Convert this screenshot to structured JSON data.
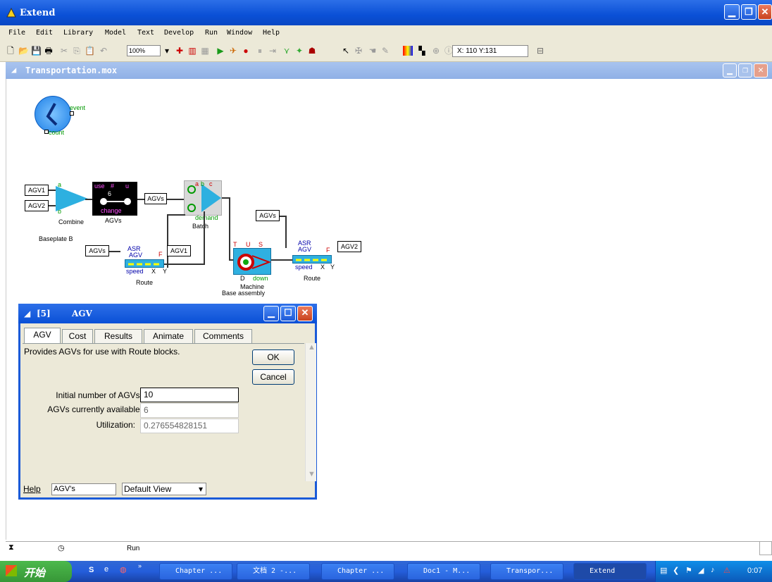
{
  "app": {
    "title": "Extend"
  },
  "menu": [
    "File",
    "Edit",
    "Library",
    "Model",
    "Text",
    "Develop",
    "Run",
    "Window",
    "Help"
  ],
  "toolbar": {
    "zoom": "100%",
    "coords": "X: 110 Y:131"
  },
  "document": {
    "title": "Transportation.mox"
  },
  "blocks": {
    "executive": {
      "output": "event",
      "input": "count"
    },
    "agv1_label": "AGV1",
    "agv2_label": "AGV2",
    "agvs_label": "AGVs",
    "agv1_route_label": "AGV1",
    "agv2_route_label": "AGV2",
    "combine": "Combine",
    "resource_pool": {
      "label": "AGVs",
      "top": "use",
      "hash": "#",
      "u": "u",
      "change": "change",
      "count": "6"
    },
    "batch": {
      "label": "Batch",
      "demand": "demand"
    },
    "machine": {
      "label": "Machine",
      "sublabel": "Base assembly",
      "t": "T",
      "u": "U",
      "s": "S",
      "d": "D",
      "down": "down"
    },
    "route1": {
      "label": "Route",
      "asr": "ASR",
      "agv": "AGV",
      "speed": "speed",
      "x": "X",
      "y": "Y",
      "f": "F"
    },
    "route2": {
      "label": "Route",
      "asr": "ASR",
      "agv": "AGV",
      "speed": "speed",
      "x": "X",
      "y": "Y",
      "f": "F"
    },
    "baseplate": "Baseplate B",
    "ports": {
      "a": "a",
      "b": "b",
      "c": "c"
    }
  },
  "dialog": {
    "number": "[5]",
    "title": "AGV",
    "tabs": [
      "AGV",
      "Cost",
      "Results",
      "Animate",
      "Comments"
    ],
    "description": "Provides AGVs for use with Route blocks.",
    "ok": "OK",
    "cancel": "Cancel",
    "fields": [
      {
        "label": "Initial number of AGVs:",
        "value": "10"
      },
      {
        "label": "AGVs currently available:",
        "value": "6"
      },
      {
        "label": "Utilization:",
        "value": "0.276554828151"
      }
    ],
    "help": "Help",
    "help_field": "AGV's",
    "view": "Default View"
  },
  "status": {
    "run": "Run"
  },
  "taskbar": {
    "start": "开始",
    "items": [
      "Chapter ...",
      "文档 2 -...",
      "Chapter ...",
      "Doc1 - M...",
      "Transpor...",
      "Extend"
    ],
    "clock": "0:07"
  }
}
